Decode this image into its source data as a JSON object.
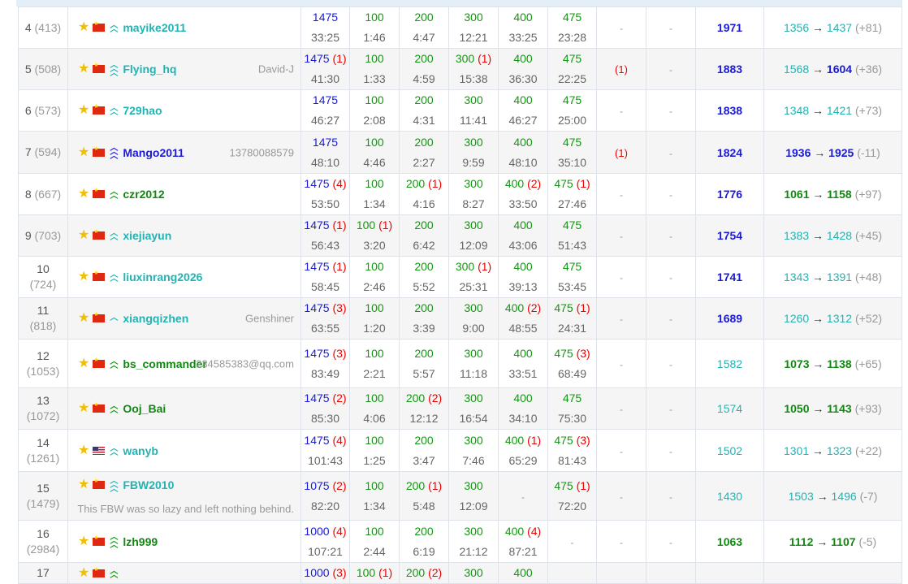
{
  "colors": {
    "blue": "#1a1ad9",
    "cyan": "#22b3b3",
    "green": "#119911",
    "dark_green": "#118811",
    "red": "#ee0000",
    "star": "#f0c000"
  },
  "rows": [
    {
      "rank": "4",
      "prev": "(413)",
      "flag": "cn",
      "chevron": "double-cyan",
      "name": "mayike2011",
      "name_color": "cyan",
      "note": "",
      "problems": [
        {
          "score": "1475",
          "tries": "",
          "time": "33:25",
          "color": "blue"
        },
        {
          "score": "100",
          "tries": "",
          "time": "1:46",
          "color": "green"
        },
        {
          "score": "200",
          "tries": "",
          "time": "4:47",
          "color": "green"
        },
        {
          "score": "300",
          "tries": "",
          "time": "12:21",
          "color": "green"
        },
        {
          "score": "400",
          "tries": "",
          "time": "33:25",
          "color": "green"
        },
        {
          "score": "475",
          "tries": "",
          "time": "23:28",
          "color": "green"
        }
      ],
      "hacks_plus": "-",
      "hacks_minus": "-",
      "perf": "1971",
      "perf_color": "blue",
      "old_rating": "1356",
      "old_color": "cyan",
      "new_rating": "1437",
      "new_color": "cyan",
      "delta": "(+81)"
    },
    {
      "rank": "5",
      "prev": "(508)",
      "flag": "cn",
      "chevron": "triple-cyan",
      "name": "Flying_hq",
      "name_color": "cyan",
      "note": "David-J",
      "problems": [
        {
          "score": "1475",
          "tries": "(1)",
          "time": "41:30",
          "color": "blue"
        },
        {
          "score": "100",
          "tries": "",
          "time": "1:33",
          "color": "green"
        },
        {
          "score": "200",
          "tries": "",
          "time": "4:59",
          "color": "green"
        },
        {
          "score": "300",
          "tries": "(1)",
          "time": "15:38",
          "color": "green"
        },
        {
          "score": "400",
          "tries": "",
          "time": "36:30",
          "color": "green"
        },
        {
          "score": "475",
          "tries": "",
          "time": "22:25",
          "color": "green"
        }
      ],
      "hacks_plus": "(1)",
      "hacks_minus": "-",
      "perf": "1883",
      "perf_color": "blue",
      "old_rating": "1568",
      "old_color": "cyan",
      "new_rating": "1604",
      "new_color": "blue",
      "delta": "(+36)"
    },
    {
      "rank": "6",
      "prev": "(573)",
      "flag": "cn",
      "chevron": "double-cyan",
      "name": "729hao",
      "name_color": "cyan",
      "note": "",
      "problems": [
        {
          "score": "1475",
          "tries": "",
          "time": "46:27",
          "color": "blue"
        },
        {
          "score": "100",
          "tries": "",
          "time": "2:08",
          "color": "green"
        },
        {
          "score": "200",
          "tries": "",
          "time": "4:31",
          "color": "green"
        },
        {
          "score": "300",
          "tries": "",
          "time": "11:41",
          "color": "green"
        },
        {
          "score": "400",
          "tries": "",
          "time": "46:27",
          "color": "green"
        },
        {
          "score": "475",
          "tries": "",
          "time": "25:00",
          "color": "green"
        }
      ],
      "hacks_plus": "-",
      "hacks_minus": "-",
      "perf": "1838",
      "perf_color": "blue",
      "old_rating": "1348",
      "old_color": "cyan",
      "new_rating": "1421",
      "new_color": "cyan",
      "delta": "(+73)"
    },
    {
      "rank": "7",
      "prev": "(594)",
      "flag": "cn",
      "chevron": "triple-blue",
      "name": "Mango2011",
      "name_color": "blue",
      "note": "13780088579",
      "problems": [
        {
          "score": "1475",
          "tries": "",
          "time": "48:10",
          "color": "blue"
        },
        {
          "score": "100",
          "tries": "",
          "time": "4:46",
          "color": "green"
        },
        {
          "score": "200",
          "tries": "",
          "time": "2:27",
          "color": "green"
        },
        {
          "score": "300",
          "tries": "",
          "time": "9:59",
          "color": "green"
        },
        {
          "score": "400",
          "tries": "",
          "time": "48:10",
          "color": "green"
        },
        {
          "score": "475",
          "tries": "",
          "time": "35:10",
          "color": "green"
        }
      ],
      "hacks_plus": "(1)",
      "hacks_minus": "-",
      "perf": "1824",
      "perf_color": "blue",
      "old_rating": "1936",
      "old_color": "blue",
      "new_rating": "1925",
      "new_color": "blue",
      "delta": "(-11)"
    },
    {
      "rank": "8",
      "prev": "(667)",
      "flag": "cn",
      "chevron": "double-green",
      "name": "czr2012",
      "name_color": "darkgreen",
      "note": "",
      "problems": [
        {
          "score": "1475",
          "tries": "(4)",
          "time": "53:50",
          "color": "blue"
        },
        {
          "score": "100",
          "tries": "",
          "time": "1:34",
          "color": "green"
        },
        {
          "score": "200",
          "tries": "(1)",
          "time": "4:16",
          "color": "green"
        },
        {
          "score": "300",
          "tries": "",
          "time": "8:27",
          "color": "green"
        },
        {
          "score": "400",
          "tries": "(2)",
          "time": "33:50",
          "color": "green"
        },
        {
          "score": "475",
          "tries": "(1)",
          "time": "27:46",
          "color": "green"
        }
      ],
      "hacks_plus": "-",
      "hacks_minus": "-",
      "perf": "1776",
      "perf_color": "blue",
      "old_rating": "1061",
      "old_color": "darkgreen",
      "new_rating": "1158",
      "new_color": "darkgreen",
      "delta": "(+97)"
    },
    {
      "rank": "9",
      "prev": "(703)",
      "flag": "cn",
      "chevron": "double-cyan",
      "name": "xiejiayun",
      "name_color": "cyan",
      "note": "",
      "problems": [
        {
          "score": "1475",
          "tries": "(1)",
          "time": "56:43",
          "color": "blue"
        },
        {
          "score": "100",
          "tries": "(1)",
          "time": "3:20",
          "color": "green"
        },
        {
          "score": "200",
          "tries": "",
          "time": "6:42",
          "color": "green"
        },
        {
          "score": "300",
          "tries": "",
          "time": "12:09",
          "color": "green"
        },
        {
          "score": "400",
          "tries": "",
          "time": "43:06",
          "color": "green"
        },
        {
          "score": "475",
          "tries": "",
          "time": "51:43",
          "color": "green"
        }
      ],
      "hacks_plus": "-",
      "hacks_minus": "-",
      "perf": "1754",
      "perf_color": "blue",
      "old_rating": "1383",
      "old_color": "cyan",
      "new_rating": "1428",
      "new_color": "cyan",
      "delta": "(+45)"
    },
    {
      "rank": "10",
      "prev": "(724)",
      "flag": "cn",
      "chevron": "double-cyan",
      "name": "liuxinrang2026",
      "name_color": "cyan",
      "note": "",
      "problems": [
        {
          "score": "1475",
          "tries": "(1)",
          "time": "58:45",
          "color": "blue"
        },
        {
          "score": "100",
          "tries": "",
          "time": "2:46",
          "color": "green"
        },
        {
          "score": "200",
          "tries": "",
          "time": "5:52",
          "color": "green"
        },
        {
          "score": "300",
          "tries": "(1)",
          "time": "25:31",
          "color": "green"
        },
        {
          "score": "400",
          "tries": "",
          "time": "39:13",
          "color": "green"
        },
        {
          "score": "475",
          "tries": "",
          "time": "53:45",
          "color": "green"
        }
      ],
      "hacks_plus": "-",
      "hacks_minus": "-",
      "perf": "1741",
      "perf_color": "blue",
      "old_rating": "1343",
      "old_color": "cyan",
      "new_rating": "1391",
      "new_color": "cyan",
      "delta": "(+48)"
    },
    {
      "rank": "11",
      "prev": "(818)",
      "flag": "cn",
      "chevron": "single-cyan",
      "name": "xiangqizhen",
      "name_color": "cyan",
      "note": "Genshiner",
      "problems": [
        {
          "score": "1475",
          "tries": "(3)",
          "time": "63:55",
          "color": "blue"
        },
        {
          "score": "100",
          "tries": "",
          "time": "1:20",
          "color": "green"
        },
        {
          "score": "200",
          "tries": "",
          "time": "3:39",
          "color": "green"
        },
        {
          "score": "300",
          "tries": "",
          "time": "9:00",
          "color": "green"
        },
        {
          "score": "400",
          "tries": "(2)",
          "time": "48:55",
          "color": "green"
        },
        {
          "score": "475",
          "tries": "(1)",
          "time": "24:31",
          "color": "green"
        }
      ],
      "hacks_plus": "-",
      "hacks_minus": "-",
      "perf": "1689",
      "perf_color": "blue",
      "old_rating": "1260",
      "old_color": "cyan",
      "new_rating": "1312",
      "new_color": "cyan",
      "delta": "(+52)"
    },
    {
      "rank": "12",
      "prev": "(1053)",
      "flag": "cn",
      "chevron": "double-green",
      "name": "bs_commander",
      "name_color": "darkgreen",
      "note": "234585383@qq.com",
      "problems": [
        {
          "score": "1475",
          "tries": "(3)",
          "time": "83:49",
          "color": "blue"
        },
        {
          "score": "100",
          "tries": "",
          "time": "2:21",
          "color": "green"
        },
        {
          "score": "200",
          "tries": "",
          "time": "5:57",
          "color": "green"
        },
        {
          "score": "300",
          "tries": "",
          "time": "11:18",
          "color": "green"
        },
        {
          "score": "400",
          "tries": "",
          "time": "33:51",
          "color": "green"
        },
        {
          "score": "475",
          "tries": "(3)",
          "time": "68:49",
          "color": "green"
        }
      ],
      "hacks_plus": "-",
      "hacks_minus": "-",
      "perf": "1582",
      "perf_color": "cyan",
      "old_rating": "1073",
      "old_color": "darkgreen",
      "new_rating": "1138",
      "new_color": "darkgreen",
      "delta": "(+65)"
    },
    {
      "rank": "13",
      "prev": "(1072)",
      "flag": "cn",
      "chevron": "double-green",
      "name": "Ooj_Bai",
      "name_color": "darkgreen",
      "note": "",
      "problems": [
        {
          "score": "1475",
          "tries": "(2)",
          "time": "85:30",
          "color": "blue"
        },
        {
          "score": "100",
          "tries": "",
          "time": "4:06",
          "color": "green"
        },
        {
          "score": "200",
          "tries": "(2)",
          "time": "12:12",
          "color": "green"
        },
        {
          "score": "300",
          "tries": "",
          "time": "16:54",
          "color": "green"
        },
        {
          "score": "400",
          "tries": "",
          "time": "34:10",
          "color": "green"
        },
        {
          "score": "475",
          "tries": "",
          "time": "75:30",
          "color": "green"
        }
      ],
      "hacks_plus": "-",
      "hacks_minus": "-",
      "perf": "1574",
      "perf_color": "cyan",
      "old_rating": "1050",
      "old_color": "darkgreen",
      "new_rating": "1143",
      "new_color": "darkgreen",
      "delta": "(+93)"
    },
    {
      "rank": "14",
      "prev": "(1261)",
      "flag": "us",
      "chevron": "double-cyan",
      "name": "wanyb",
      "name_color": "cyan",
      "note": "",
      "problems": [
        {
          "score": "1475",
          "tries": "(4)",
          "time": "101:43",
          "color": "blue"
        },
        {
          "score": "100",
          "tries": "",
          "time": "1:25",
          "color": "green"
        },
        {
          "score": "200",
          "tries": "",
          "time": "3:47",
          "color": "green"
        },
        {
          "score": "300",
          "tries": "",
          "time": "7:46",
          "color": "green"
        },
        {
          "score": "400",
          "tries": "(1)",
          "time": "65:29",
          "color": "green"
        },
        {
          "score": "475",
          "tries": "(3)",
          "time": "81:43",
          "color": "green"
        }
      ],
      "hacks_plus": "-",
      "hacks_minus": "-",
      "perf": "1502",
      "perf_color": "cyan",
      "old_rating": "1301",
      "old_color": "cyan",
      "new_rating": "1323",
      "new_color": "cyan",
      "delta": "(+22)"
    },
    {
      "rank": "15",
      "prev": "(1479)",
      "flag": "cn",
      "chevron": "triple-cyan",
      "name": "FBW2010",
      "name_color": "cyan",
      "note": "This FBW was so lazy and left nothing behind.",
      "problems": [
        {
          "score": "1075",
          "tries": "(2)",
          "time": "82:20",
          "color": "blue"
        },
        {
          "score": "100",
          "tries": "",
          "time": "1:34",
          "color": "green"
        },
        {
          "score": "200",
          "tries": "(1)",
          "time": "5:48",
          "color": "green"
        },
        {
          "score": "300",
          "tries": "",
          "time": "12:09",
          "color": "green"
        },
        {
          "score": "-",
          "tries": "",
          "time": "",
          "color": "dash"
        },
        {
          "score": "475",
          "tries": "(1)",
          "time": "72:20",
          "color": "green"
        }
      ],
      "hacks_plus": "-",
      "hacks_minus": "-",
      "perf": "1430",
      "perf_color": "cyan",
      "old_rating": "1503",
      "old_color": "cyan",
      "new_rating": "1496",
      "new_color": "cyan",
      "delta": "(-7)"
    },
    {
      "rank": "16",
      "prev": "(2984)",
      "flag": "cn",
      "chevron": "triple-green",
      "name": "lzh999",
      "name_color": "darkgreen",
      "note": "",
      "problems": [
        {
          "score": "1000",
          "tries": "(4)",
          "time": "107:21",
          "color": "blue"
        },
        {
          "score": "100",
          "tries": "",
          "time": "2:44",
          "color": "green"
        },
        {
          "score": "200",
          "tries": "",
          "time": "6:19",
          "color": "green"
        },
        {
          "score": "300",
          "tries": "",
          "time": "21:12",
          "color": "green"
        },
        {
          "score": "400",
          "tries": "(4)",
          "time": "87:21",
          "color": "green"
        },
        {
          "score": "-",
          "tries": "",
          "time": "",
          "color": "dash"
        }
      ],
      "hacks_plus": "-",
      "hacks_minus": "-",
      "perf": "1063",
      "perf_color": "darkgreen",
      "old_rating": "1112",
      "old_color": "darkgreen",
      "new_rating": "1107",
      "new_color": "darkgreen",
      "delta": "(-5)"
    },
    {
      "rank": "17",
      "prev": "",
      "flag": "cn",
      "chevron": "double-green",
      "name": "",
      "name_color": "darkgreen",
      "note": "",
      "problems": [
        {
          "score": "1000",
          "tries": "(3)",
          "time": "",
          "color": "blue"
        },
        {
          "score": "100",
          "tries": "(1)",
          "time": "",
          "color": "green"
        },
        {
          "score": "200",
          "tries": "(2)",
          "time": "",
          "color": "green"
        },
        {
          "score": "300",
          "tries": "",
          "time": "",
          "color": "green"
        },
        {
          "score": "400",
          "tries": "",
          "time": "",
          "color": "green"
        },
        {
          "score": "",
          "tries": "",
          "time": "",
          "color": "dash"
        }
      ],
      "hacks_plus": "",
      "hacks_minus": "",
      "perf": "",
      "perf_color": "blue",
      "old_rating": "",
      "old_color": "cyan",
      "new_rating": "",
      "new_color": "cyan",
      "delta": ""
    }
  ]
}
